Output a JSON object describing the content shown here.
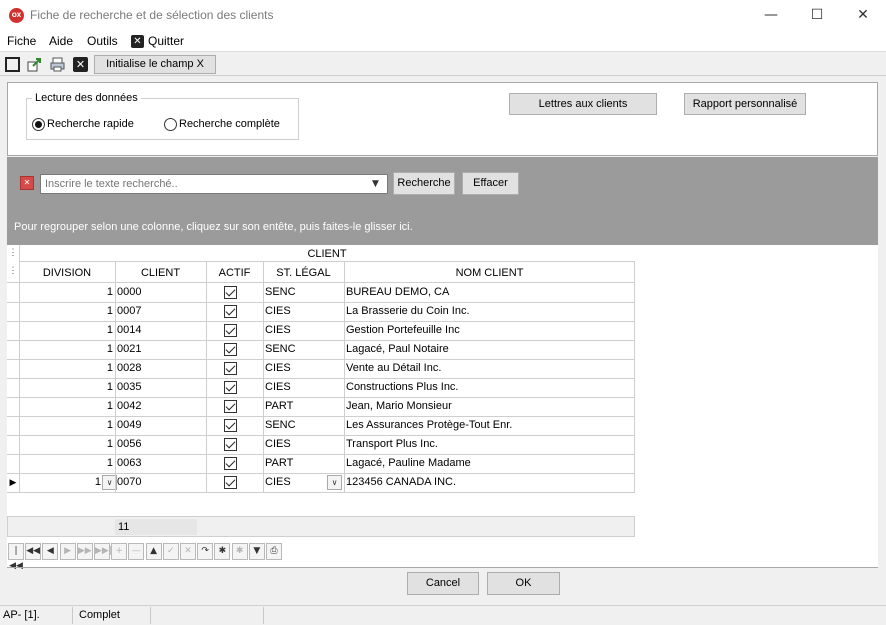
{
  "window": {
    "title": "Fiche de recherche et de sélection des clients",
    "app_icon": "OX",
    "controls": [
      "—",
      "☐",
      "✕"
    ]
  },
  "menu": {
    "items": [
      "Fiche",
      "Aide",
      "Outils"
    ],
    "quit_label": "Quitter"
  },
  "toolbar": {
    "icons": [
      "frame-icon",
      "export-icon",
      "print-icon",
      "close-icon"
    ],
    "init_label": "Initialise le champ X"
  },
  "reading": {
    "group_title": "Lecture des données",
    "options": [
      {
        "label": "Recherche rapide",
        "selected": true
      },
      {
        "label": "Recherche complète",
        "selected": false
      }
    ]
  },
  "actions": {
    "letters_label": "Lettres aux clients",
    "report_label": "Rapport personnalisé"
  },
  "search": {
    "placeholder": "Inscrire le texte recherché..",
    "search_label": "Recherche",
    "clear_label": "Effacer",
    "group_hint": "Pour regrouper selon une colonne, cliquez sur son entête, puis faites-le glisser ici."
  },
  "grid": {
    "band_title": "CLIENT",
    "columns": [
      "DIVISION",
      "CLIENT",
      "ACTIF",
      "ST. LÉGAL",
      "NOM CLIENT"
    ],
    "rows": [
      {
        "division": "1",
        "client": "0000",
        "actif": true,
        "statut": "SENC",
        "nom": "BUREAU DEMO, CA"
      },
      {
        "division": "1",
        "client": "0007",
        "actif": true,
        "statut": "CIES",
        "nom": "La Brasserie du Coin Inc."
      },
      {
        "division": "1",
        "client": "0014",
        "actif": true,
        "statut": "CIES",
        "nom": "Gestion Portefeuille Inc"
      },
      {
        "division": "1",
        "client": "0021",
        "actif": true,
        "statut": "SENC",
        "nom": "Lagacé, Paul Notaire"
      },
      {
        "division": "1",
        "client": "0028",
        "actif": true,
        "statut": "CIES",
        "nom": "Vente au Détail Inc."
      },
      {
        "division": "1",
        "client": "0035",
        "actif": true,
        "statut": "CIES",
        "nom": "Constructions Plus  Inc."
      },
      {
        "division": "1",
        "client": "0042",
        "actif": true,
        "statut": "PART",
        "nom": "Jean, Mario Monsieur"
      },
      {
        "division": "1",
        "client": "0049",
        "actif": true,
        "statut": "SENC",
        "nom": "Les Assurances Protège-Tout Enr."
      },
      {
        "division": "1",
        "client": "0056",
        "actif": true,
        "statut": "CIES",
        "nom": "Transport Plus Inc."
      },
      {
        "division": "1",
        "client": "0063",
        "actif": true,
        "statut": "PART",
        "nom": "Lagacé, Pauline Madame"
      },
      {
        "division": "1",
        "client": "0070",
        "actif": true,
        "statut": "CIES",
        "nom": "123456 CANADA INC."
      }
    ],
    "current_row_index": 10,
    "summary_count": "11"
  },
  "navigator": {
    "buttons": [
      "|◀◀",
      "◀◀",
      "◀",
      "▶",
      "▶▶",
      "▶▶|",
      "+",
      "—",
      "▲",
      "✓",
      "✕",
      "↷",
      "✱",
      "✱",
      "▼",
      "⎙"
    ]
  },
  "dialog": {
    "cancel_label": "Cancel",
    "ok_label": "OK"
  },
  "status": {
    "left": "AP- [1].",
    "mode": "Complet"
  }
}
